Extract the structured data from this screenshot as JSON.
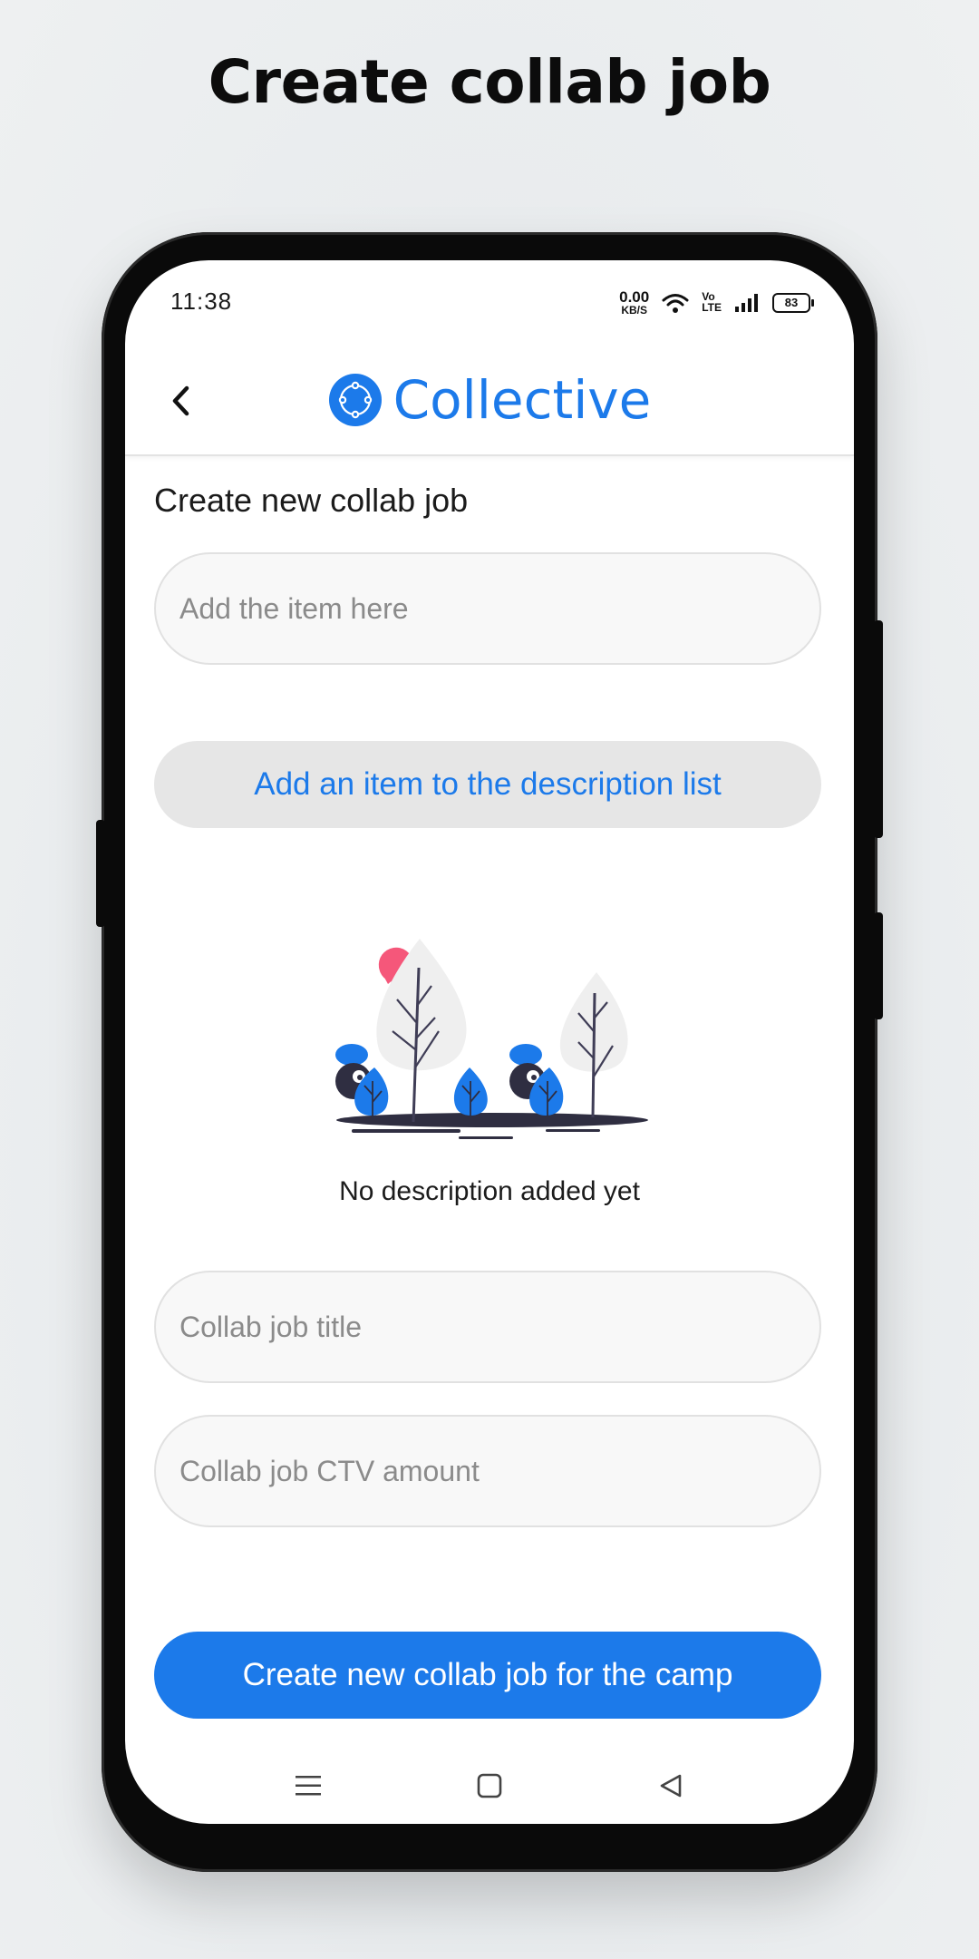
{
  "page_heading": "Create collab job",
  "status_bar": {
    "time": "11:38",
    "net_speed_value": "0.00",
    "net_speed_unit": "KB/S",
    "volte_top": "Vo",
    "volte_bottom": "LTE",
    "battery": "83"
  },
  "header": {
    "app_name": "Collective"
  },
  "form": {
    "section_title": "Create new collab job",
    "item_input": {
      "placeholder": "Add the item here",
      "value": ""
    },
    "add_item_button": "Add an item to the description list",
    "empty_state_text": "No description added yet",
    "title_input": {
      "placeholder": "Collab job title",
      "value": ""
    },
    "ctv_input": {
      "placeholder": "Collab job CTV amount",
      "value": ""
    },
    "submit_button": "Create new collab job for the camp"
  },
  "icons": {
    "back": "chevron-left-icon",
    "logo": "collective-logo-icon",
    "nav_menu": "menu-icon",
    "nav_home": "square-home-icon",
    "nav_back": "triangle-back-icon"
  },
  "colors": {
    "accent": "#1c7aea",
    "illustration_pink": "#f5577a",
    "illustration_dark": "#2f2e41",
    "illustration_tree": "#efefef"
  }
}
